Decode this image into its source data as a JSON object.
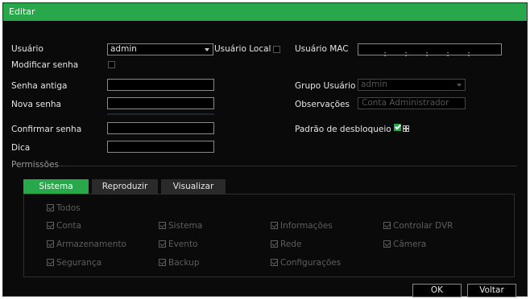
{
  "title": "Editar",
  "labels": {
    "usuario": "Usuário",
    "usuario_local": "Usuário Local",
    "usuario_mac": "Usuário MAC",
    "modificar_senha": "Modificar senha",
    "senha_antiga": "Senha antiga",
    "grupo_usuario": "Grupo Usuário",
    "nova_senha": "Nova senha",
    "observacoes": "Observações",
    "confirmar_senha": "Confirmar senha",
    "padrao_desbloqueio": "Padrão de desbloqueio",
    "dica": "Dica",
    "permissoes": "Permissões"
  },
  "values": {
    "usuario": "admin",
    "grupo_usuario": "admin",
    "observacoes_placeholder": "Conta Administrador",
    "mac_separators": [
      ":",
      ":",
      ":",
      ":",
      ":"
    ]
  },
  "tabs": [
    "Sistema",
    "Reproduzir",
    "Visualizar"
  ],
  "permissions": {
    "all": "Todos",
    "rows": [
      [
        "Conta",
        "Sistema",
        "Informações",
        "Controlar DVR"
      ],
      [
        "Armazenamento",
        "Evento",
        "Rede",
        "Câmera"
      ],
      [
        "Segurança",
        "Backup",
        "Configurações"
      ]
    ]
  },
  "buttons": {
    "ok": "OK",
    "back": "Voltar"
  },
  "colors": {
    "accent": "#28a84a",
    "background": "#0a0a0a",
    "disabled_text": "#5e5e5e"
  }
}
